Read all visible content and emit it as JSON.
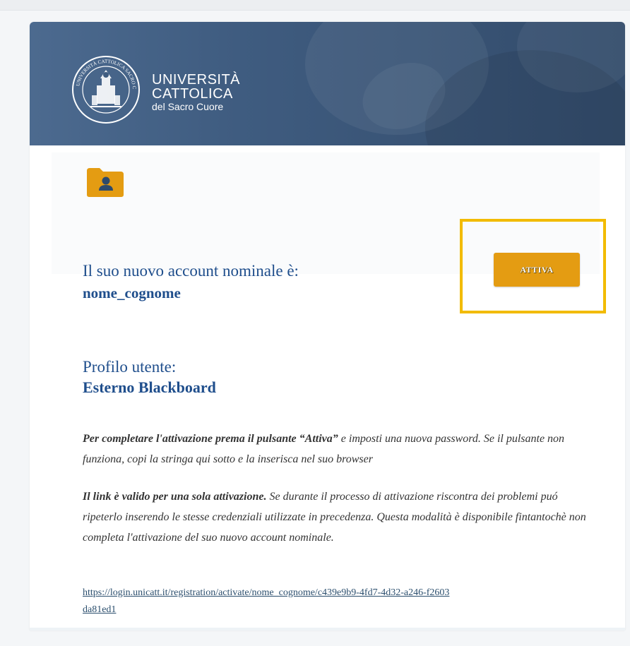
{
  "header": {
    "university_line1": "UNIVERSITÀ",
    "university_line2": "CATTOLICA",
    "university_line3": "del Sacro Cuore",
    "seal_text": "UNIVERSITÀ CATTOLICA SACRO CUORE MEDIOLANI",
    "background_color": "#3f5c80"
  },
  "account": {
    "label": "Il suo nuovo account nominale è:",
    "username": "nome_cognome",
    "icon": "user-folder-icon"
  },
  "activate_button": {
    "label": "ATTIVA",
    "color": "#e49c12",
    "highlight_color": "#f2bb00"
  },
  "profile": {
    "label": "Profilo utente:",
    "value": "Esterno Blackboard"
  },
  "instructions": {
    "p1_bold": "Per completare l'attivazione prema il pulsante “Attiva”",
    "p1_rest": " e imposti una nuova password. Se il pulsante non funziona, copi la stringa qui sotto e la inserisca nel suo browser",
    "p2_bold": "Il link è valido per una sola attivazione.",
    "p2_rest": " Se durante il processo di attivazione riscontra dei problemi puó ripeterlo inserendo le stesse credenziali utilizzate in precedenza. Questa modalità è disponibile fintantochè non completa l'attivazione del suo nuovo account nominale."
  },
  "activation_link": "https://login.unicatt.it/registration/activate/nome_cognome/c439e9b9-4fd7-4d32-a246-f2603da81ed1"
}
